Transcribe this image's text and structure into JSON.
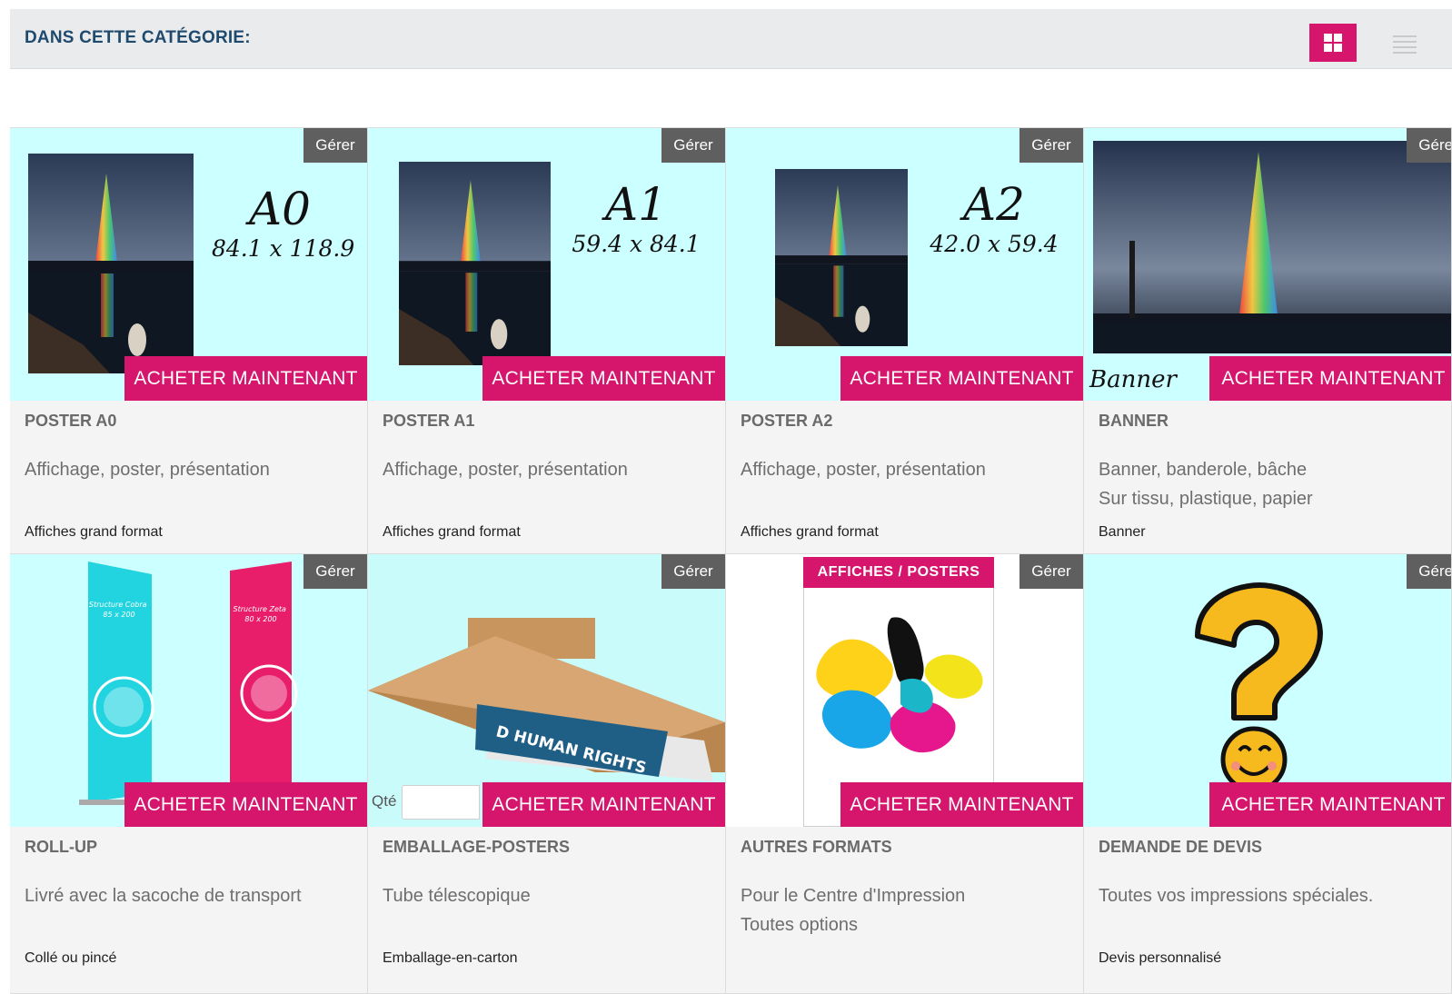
{
  "header": {
    "title": "DANS CETTE CATÉGORIE:",
    "grid_view_icon": "grid-icon",
    "list_view_icon": "list-icon"
  },
  "colors": {
    "accent": "#d6156c",
    "header_bg": "#e9ebec",
    "title_color": "#1f4a6e",
    "manage_bg": "#5f5f5f",
    "image_bg": "#ccffff"
  },
  "labels": {
    "manage": "Gérer",
    "buy": "ACHETER MAINTENANT",
    "qty": "Qté"
  },
  "products": [
    {
      "title": "POSTER A0",
      "description": "Affichage, poster, présentation",
      "category": "Affiches grand format",
      "image_text": {
        "format": "A0",
        "size": "84.1 x 118.9"
      }
    },
    {
      "title": "POSTER A1",
      "description": "Affichage, poster, présentation",
      "category": "Affiches grand format",
      "image_text": {
        "format": "A1",
        "size": "59.4 x 84.1"
      }
    },
    {
      "title": "POSTER A2",
      "description": "Affichage, poster, présentation",
      "category": "Affiches grand format",
      "image_text": {
        "format": "A2",
        "size": "42.0 x 59.4"
      }
    },
    {
      "title": "BANNER",
      "description": "Banner, banderole, bâche\nSur tissu, plastique, papier",
      "category": "Banner",
      "image_text": {
        "word": "Banner"
      }
    },
    {
      "title": "ROLL-UP",
      "description": "Livré avec la sacoche de transport",
      "category": "Collé ou pincé",
      "image_text": {
        "left": "Structure Cobra 85 x 200",
        "right": "Structure Zeta 80 x 200"
      }
    },
    {
      "title": "EMBALLAGE-POSTERS",
      "description": "Tube télescopique",
      "category": "Emballage-en-carton",
      "image_text": {
        "tube": "D HUMAN RIGHTS"
      }
    },
    {
      "title": "AUTRES FORMATS",
      "description": "Pour le Centre d'Impression\nToutes options",
      "category": "",
      "image_text": {
        "tab": "AFFICHES / POSTERS"
      }
    },
    {
      "title": "DEMANDE DE DEVIS",
      "description": "Toutes vos impressions spéciales.",
      "category": "Devis personnalisé",
      "image_text": {}
    }
  ]
}
